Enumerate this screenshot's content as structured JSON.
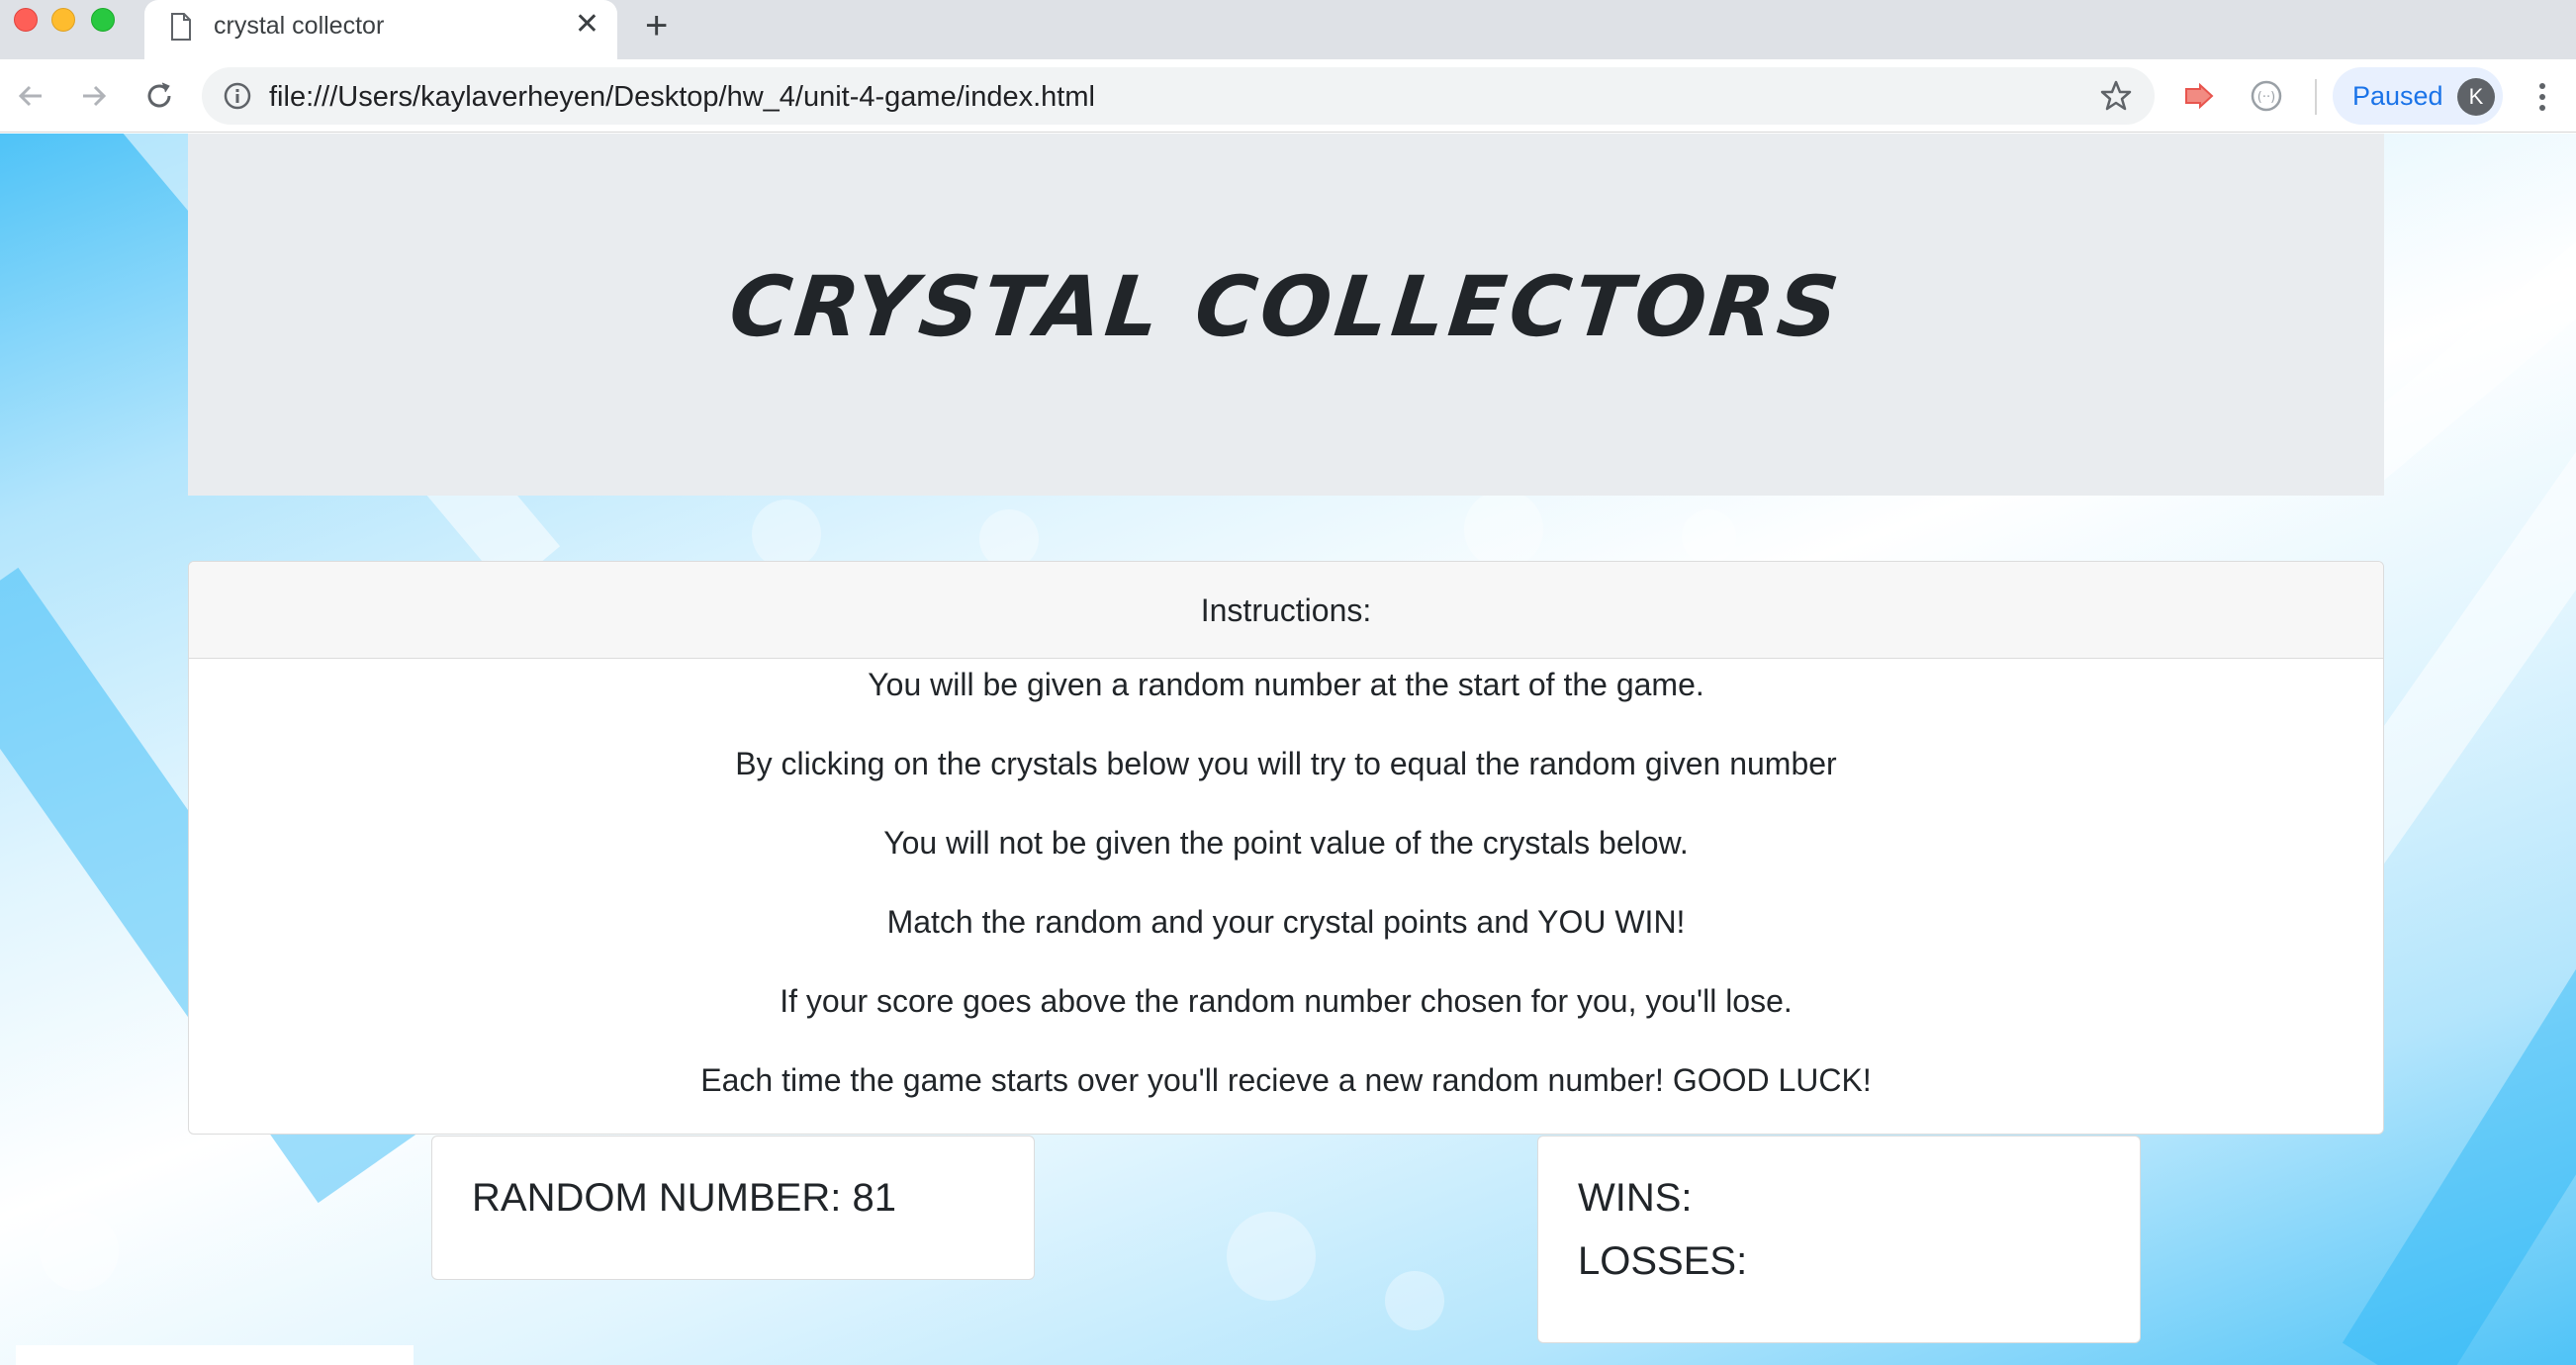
{
  "browser": {
    "tab_title": "crystal collector",
    "tab_close": "✕",
    "new_tab": "+",
    "url": "file:///Users/kaylaverheyen/Desktop/hw_4/unit-4-game/index.html",
    "profile_status": "Paused",
    "avatar_initial": "K"
  },
  "page": {
    "title": "CRYSTAL COLLECTORS",
    "instructions": {
      "header": "Instructions:",
      "lines": [
        "You will be given a random number at the start of the game.",
        "By clicking on the crystals below you will try to equal the random given number",
        "You will not be given the point value of the crystals below.",
        "Match the random and your crystal points and YOU WIN!",
        "If your score goes above the random number chosen for you, you'll lose.",
        "Each time the game starts over you'll recieve a new random number! GOOD LUCK!"
      ]
    },
    "random_number_label": "RANDOM NUMBER: 81",
    "wins_label": "WINS:",
    "losses_label": "LOSSES:"
  },
  "colors": {
    "tabbar_bg": "#dee1e6",
    "jumbotron_bg": "#e9ecef",
    "accent_blue": "#1a73e8",
    "text": "#212529"
  }
}
